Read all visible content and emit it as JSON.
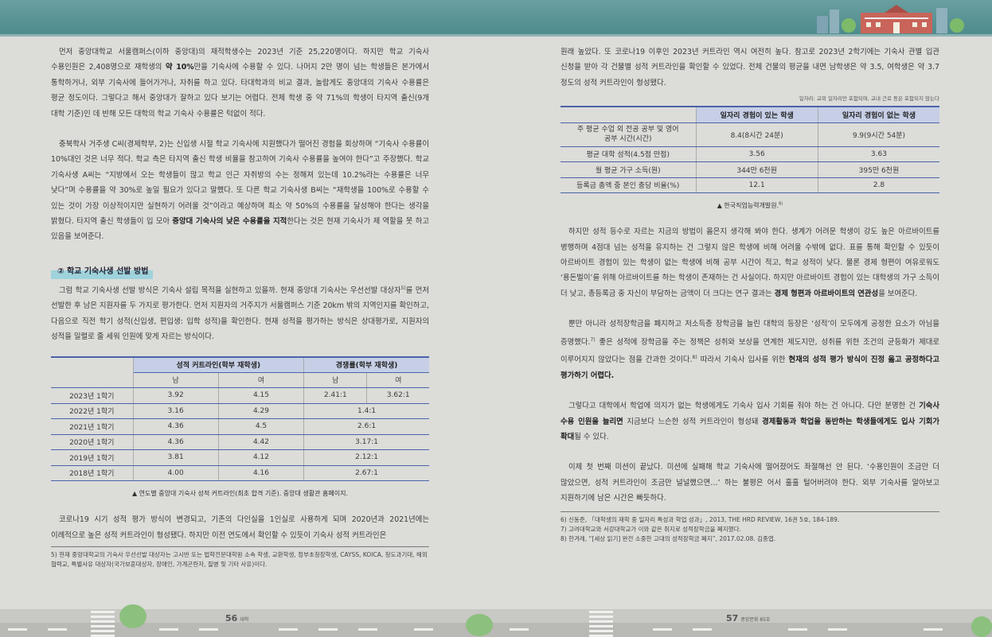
{
  "left": {
    "p1": "먼저 중앙대학교 서울캠퍼스(이하 중앙대)의 재적학생수는 2023년 기준 25,220명이다. 하지만 학교 기숙사 수용인원은 2,408명으로 재학생의 ",
    "p1_bold": "약 10%",
    "p1_rest": "만을 기숙사에 수용할 수 있다. 나머지 2만 명이 넘는 학생들은 본가에서 통학하거나, 외부 기숙사에 들어가거나, 자취를 하고 있다. 타대학과의 비교 결과, 놀랍게도 중앙대의 기숙사 수용률은 평균 정도이다. 그렇다고 해서 중앙대가 잘하고 있다 보기는 어렵다. 전체 학생 중 약 71%의 학생이 타지역 출신(9개 대학 기준)인 데 반해 모든 대학의 학교 기숙사 수용률은 턱없이 적다.",
    "p2": "충북학사 거주생 C씨(경제학부, 2)는 신입생 시절 학교 기숙사에 지원했다가 떨어진 경험을 회상하며 “기숙사 수용률이 10%대인 것은 너무 적다. 학교 측은 타지역 출신 학생 비율을 참고하여 기숙사 수용률을 높여야 한다”고 주장했다. 학교 기숙사생 A씨는 “지방에서 오는 학생들이 많고 학교 인근 자취방의 수는 정해져 있는데 10.2%라는 수용률은 너무 낮다”며 수용률을 약 30%로 높일 필요가 있다고 말했다. 또 다른 학교 기숙사생 B씨는 “재학생을 100%로 수용할 수 있는 것이 가장 이상적이지만 실현하기 어려울 것”이라고 예상하며 최소 약 50%의 수용률을 달성해야 한다는 생각을 밝혔다. 타지역 출신 학생들이 입 모아 ",
    "p2_bold": "중앙대 기숙사의 낮은 수용률을 지적",
    "p2_rest": "한다는 것은 현재 기숙사가 제 역할을 못 하고 있음을 보여준다.",
    "subhead": "② 학교 기숙사생 선발 방법",
    "p3a": "그럼 학교 기숙사생 선발 방식은 기숙사 설립 목적을 실현하고 있을까. 현재 중앙대 기숙사는 우선선발 대상자",
    "p3_sup": "5)",
    "p3b": "를 먼저 선발한 후 남은 지원자를 두 가지로 평가한다. 먼저 지원자의 거주지가 서울캠퍼스 기준 20km 밖의 지역인지를 확인하고, 다음으로 직전 학기 성적(신입생, 편입생: 입학 성적)을 확인한다. 현재 성적을 평가하는 방식은 상대평가로, 지원자의 성적을 일렬로 줄 세워 인원에 맞게 자르는 방식이다.",
    "table": {
      "group1": "성적 커트라인(학부 재학생)",
      "group2": "경쟁률(학부 재학생)",
      "sub_m": "남",
      "sub_f": "여",
      "rows": [
        {
          "term": "2023년 1학기",
          "m": "3.92",
          "f": "4.15",
          "cm": "2.41:1",
          "cf": "3.62:1"
        },
        {
          "term": "2022년 1학기",
          "m": "3.16",
          "f": "4.29",
          "c": "1.4:1"
        },
        {
          "term": "2021년 1학기",
          "m": "4.36",
          "f": "4.5",
          "c": "2.6:1"
        },
        {
          "term": "2020년 1학기",
          "m": "4.36",
          "f": "4.42",
          "c": "3.17:1"
        },
        {
          "term": "2019년 1학기",
          "m": "3.81",
          "f": "4.12",
          "c": "2.12:1"
        },
        {
          "term": "2018년 1학기",
          "m": "4.00",
          "f": "4.16",
          "c": "2.67:1"
        }
      ],
      "caption": "▲ 연도별 중앙대 기숙사 성적 커트라인(최초 합격 기준). 중앙대 생활관 홈페이지."
    },
    "p4": "코로나19 시기 성적 평가 방식이 변경되고, 기존의 다인실을 1인실로 사용하게 되며 2020년과 2021년에는 이례적으로 높은 성적 커트라인이 형성됐다. 하지만 이전 연도에서 확인할 수 있듯이 기숙사 성적 커트라인은",
    "footnote": "5)   현재 중앙대학교의 기숙사 우선선발 대상자는 고시반 또는 법학전문대학원 소속 학생, 교환학생, 정부초청장학생, CAYSS, KOICA, 청도과기대, 해외협력교, 특별사유 대상자(국가보훈대상자, 장애인, 가계곤란자, 질병 및 기타 사유)이다."
  },
  "right": {
    "p1": "원래 높았다. 또 코로나19 이후인 2023년 커트라인 역시 여전히 높다. 참고로 2023년 2학기에는 기숙사 관별 입관 신청을 받아 각 건물별 성적 커트라인을 확인할 수 있었다. 전체 건물의 평균을 내면 남학생은 약 3.5, 여학생은 약 3.7 정도의 성적 커트라인이 형성됐다.",
    "table_note": "일자리: 교외 일자리만 포함되며, 교내 근로 등은 포함되지 않는다",
    "table": {
      "h1": "일자리 경험이 있는 학생",
      "h2": "일자리 경험이 없는 학생",
      "rows": [
        {
          "label": "주 평균 수업 외 전공 공부 및 영어 공부 시간(시간)",
          "a": "8.4(8시간 24분)",
          "b": "9.9(9시간 54분)"
        },
        {
          "label": "평균 대학 성적(4.5점 만점)",
          "a": "3.56",
          "b": "3.63"
        },
        {
          "label": "월 평균 가구 소득(원)",
          "a": "344만 6천원",
          "b": "395만 6천원"
        },
        {
          "label": "등록금 총액 중 본인 충당 비율(%)",
          "a": "12.1",
          "b": "2.8"
        }
      ],
      "caption": "▲ 한국직업능력개발원.",
      "caption_sup": "6)"
    },
    "p2a": "하지만 성적 등수로 자르는 지금의 방법이 옳은지 생각해 봐야 한다. 생계가 어려운 학생이 강도 높은 아르바이트를 병행하며 4점대 넘는 성적을 유지하는 건 그렇지 않은 학생에 비해 어려울 수밖에 없다. 표를 통해 확인할 수 있듯이 아르바이트 경험이 있는 학생이 없는 학생에 비해 공부 시간이 적고, 학교 성적이 낮다. 물론 경제 형편이 여유로워도 ‘용돈벌이’를 위해 아르바이트를 하는 학생이 존재하는 건 사실이다. 하지만 아르바이트 경험이 있는 대학생의 가구 소득이 더 낮고, 총등록금 중 자신이 부담하는 금액이 더 크다는 연구 결과는 ",
    "p2_bold": "경제 형편과 아르바이트의 연관성",
    "p2b": "을 보여준다.",
    "p3a": "뿐만 아니라 성적장학금을 폐지하고 저소득층 장학금을 늘린 대학의 등장은 ‘성적’이 모두에게 공정한 요소가 아님을 증명했다.",
    "p3_sup1": "7)",
    "p3b": " 좋은 성적에 장학금을 주는 정책은 성취와 보상을 연계한 제도지만, 성취를 위한 조건의 균등화가 제대로 이루어지지 않았다는 점을 간과한 것이다.",
    "p3_sup2": "8)",
    "p3c": " 따라서 기숙사 입사를 위한 ",
    "p3_bold": "현재의 성적 평가 방식이 진정 옳고 공정하다고 평가하기 어렵다.",
    "p4a": "그렇다고 대학에서 학업에 의지가 없는 학생에게도 기숙사 입사 기회를 줘야 하는 건 아니다. 다만 분명한 건 ",
    "p4_bold1": "기숙사 수용 인원을 늘리면",
    "p4b": " 지금보다 느슨한 성적 커트라인이 형성돼 ",
    "p4_bold2": "경제활동과 학업을 동반하는 학생들에게도 입사 기회가 확대",
    "p4c": "될 수 있다.",
    "p5": "이제 첫 번째 미션이 끝났다. 미션에 실패해 학교 기숙사에 떨어졌어도 좌절해선 안 된다. ‘수용인원이 조금만 더 많았으면, 성적 커트라인이 조금만 널널했으면…’ 하는 불평은 어서 훌훌 털어버려야 한다. 외부 기숙사를 알아보고 지원하기에 남은 시간은 빠듯하다.",
    "footnotes": [
      "6)    신동준, 「대학생의 재학 중 일자리 특성과 학업 성과」, 2013, THE HRD REVIEW, 16권 5호, 184-189.",
      "7)    고려대학교와 서강대학교가 이와 같은 취지로 성적장학금을 폐지했다.",
      "8)    한겨레, “[세상 읽기] 완전 소중한 고대의 성적장학금 폐지”, 2017.02.08. 김종엽."
    ]
  },
  "footer": {
    "left_num": "56",
    "left_label": "대학",
    "right_num": "57",
    "right_label": "중앙문화 85호"
  },
  "colors": {
    "accent": "#4a63a8",
    "table_header": "#c6cfe6",
    "highlight": "#9fd3dc",
    "top_band": "#5a9596"
  }
}
